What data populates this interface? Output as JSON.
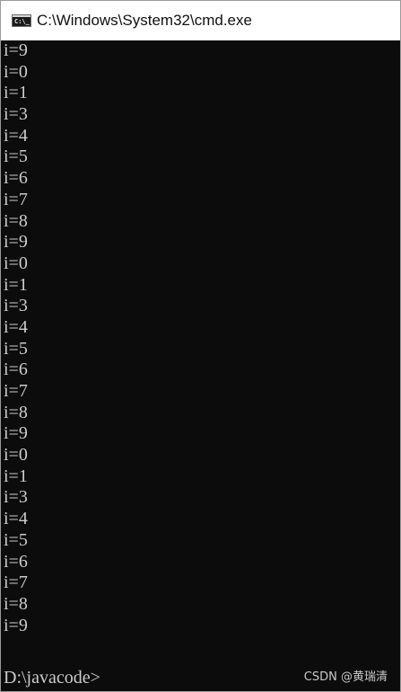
{
  "window": {
    "title": "C:\\Windows\\System32\\cmd.exe",
    "icon": "cmd-console-icon",
    "icon_text": "C:\\_"
  },
  "console": {
    "lines": [
      "i=9",
      "i=0",
      "i=1",
      "i=3",
      "i=4",
      "i=5",
      "i=6",
      "i=7",
      "i=8",
      "i=9",
      "i=0",
      "i=1",
      "i=3",
      "i=4",
      "i=5",
      "i=6",
      "i=7",
      "i=8",
      "i=9",
      "i=0",
      "i=1",
      "i=3",
      "i=4",
      "i=5",
      "i=6",
      "i=7",
      "i=8",
      "i=9"
    ],
    "prompt": "D:\\javacode>"
  },
  "watermark": "CSDN @黄瑞清",
  "colors": {
    "console_background": "#0c0c0c",
    "console_text": "#cccccc",
    "titlebar_background": "#ffffff"
  }
}
